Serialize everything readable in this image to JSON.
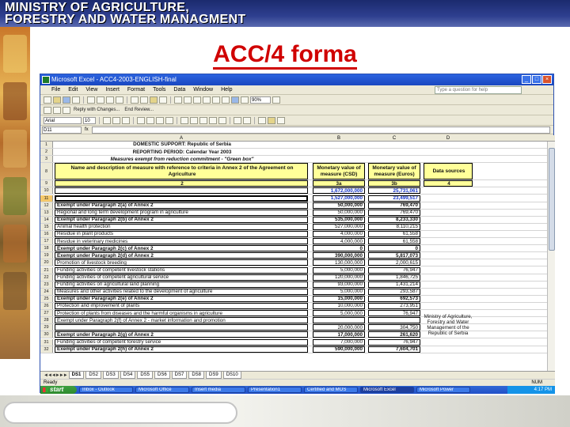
{
  "header": {
    "line1": "MINISTRY OF AGRICULTURE,",
    "line2": "FORESTRY AND WATER MANAGMENT"
  },
  "slide_title": "ACC/4 forma",
  "excel": {
    "window_title": "Microsoft Excel - ACC4-2003-ENGLISH-final",
    "menus": [
      "File",
      "Edit",
      "View",
      "Insert",
      "Format",
      "Tools",
      "Data",
      "Window",
      "Help"
    ],
    "help_placeholder": "Type a question for help",
    "toolbar": {
      "zoom": "90%",
      "font": "Arial",
      "size": "10",
      "reply_label": "Reply with Changes...",
      "end_review_label": "End Review..."
    },
    "name_box": "D11",
    "fx": "fx",
    "columns": [
      "A",
      "B",
      "C",
      "D"
    ],
    "rows": [
      {
        "n": "1",
        "a": "DOMESTIC SUPPORT: Republic of Serbia",
        "b": "",
        "c": "",
        "d": ""
      },
      {
        "n": "2",
        "a": "REPORTING PERIOD: Calendar Year 2003",
        "b": "",
        "c": "",
        "d": ""
      },
      {
        "n": "3",
        "a": "Measures exempt from reduction commitment - \"Green box\"",
        "b": "",
        "c": "",
        "d": ""
      },
      {
        "n": "8",
        "a": "Name and description of measure with reference to criteria in Annex 2 of the Agreement on Agriculture",
        "b": "Monetary value of measure (CSD)",
        "c": "Monetary value of measure (Euros)",
        "d": "Data sources"
      },
      {
        "n": "9",
        "a": "2",
        "b": "3a",
        "c": "3b",
        "d": "4"
      },
      {
        "n": "10",
        "a": "",
        "b": "1,672,000,000",
        "c": "25,731,061",
        "d": ""
      },
      {
        "n": "11",
        "a": "",
        "b": "1,527,000,000",
        "c": "23,499,517",
        "d": ""
      },
      {
        "n": "12",
        "a": "Exempt under Paragraph 2(a) of Annex 2",
        "b": "50,000,000",
        "c": "769,470",
        "d": ""
      },
      {
        "n": "13",
        "a": "Regional and long term development program in agriculture",
        "b": "50,000,000",
        "c": "769,470",
        "d": ""
      },
      {
        "n": "14",
        "a": "Exempt under Paragraph 2(b) of Annex 2",
        "b": "535,000,000",
        "c": "8,233,330",
        "d": ""
      },
      {
        "n": "15",
        "a": "Animal health protection",
        "b": "527,000,000",
        "c": "8,110,215",
        "d": ""
      },
      {
        "n": "16",
        "a": "Residue in plant products",
        "b": "4,000,000",
        "c": "61,558",
        "d": ""
      },
      {
        "n": "17",
        "a": "Residue in veterinary medicines",
        "b": "4,000,000",
        "c": "61,558",
        "d": ""
      },
      {
        "n": "18",
        "a": "Exempt under Paragraph 2(c) of Annex 2",
        "b": "0",
        "c": "0",
        "d": ""
      },
      {
        "n": "19",
        "a": "Exempt under Paragraph 2(d) of Annex 2",
        "b": "390,000,000",
        "c": "5,817,073",
        "d": ""
      },
      {
        "n": "20",
        "a": "Promotion of livestock breeding",
        "b": "130,000,000",
        "c": "2,000,615",
        "d": ""
      },
      {
        "n": "21",
        "a": "Funding activities of competent livestock stations",
        "b": "5,000,000",
        "c": "76,947",
        "d": ""
      },
      {
        "n": "22",
        "a": "Funding activities of competent agricultural service",
        "b": "120,000,000",
        "c": "1,846,725",
        "d": ""
      },
      {
        "n": "23",
        "a": "Funding activities on agricultural land planning",
        "b": "93,000,000",
        "c": "1,431,214",
        "d": ""
      },
      {
        "n": "24",
        "a": "Measures and other activities related to the development of agriculture",
        "b": "5,000,000",
        "c": "293,587",
        "d": ""
      },
      {
        "n": "25",
        "a": "Exempt under Paragraph 2(e) of Annex 2",
        "b": "15,000,000",
        "c": "692,573",
        "d": ""
      },
      {
        "n": "26",
        "a": "Protection and improvement of plants",
        "b": "10,000,000",
        "c": "273,951",
        "d": ""
      },
      {
        "n": "27",
        "a": "Protection of plants from diseases and the harmful organisms in agriculture",
        "b": "5,000,000",
        "c": "76,947",
        "d": ""
      },
      {
        "n": "28",
        "a": "Exempt under Paragraph 2(f) of Annex 2 - market information and promotion",
        "b": "",
        "c": "",
        "d": ""
      },
      {
        "n": "29",
        "a": "",
        "b": "20,000,000",
        "c": "304,750",
        "d": ""
      },
      {
        "n": "30",
        "a": "Exempt under Paragraph 2(g) of Annex 2",
        "b": "17,000,000",
        "c": "261,620",
        "d": ""
      },
      {
        "n": "31",
        "a": "Funding activities of competent forestry service",
        "b": "7,000,000",
        "c": "76,947",
        "d": ""
      },
      {
        "n": "32",
        "a": "Exempt under Paragraph 2(h) of Annex 2",
        "b": "590,000,000",
        "c": "7,604,701",
        "d": ""
      }
    ],
    "data_source_note": "Ministry of Agriculture, Forestry and Water Management of the Republic of Serbia",
    "sheet_tabs": [
      "DS1",
      "DS2",
      "DS3",
      "DS4",
      "DS5",
      "DS6",
      "DS7",
      "DS8",
      "DS9",
      "DS10"
    ],
    "status": "Ready",
    "status_num": "NUM",
    "start_label": "start",
    "tasks": [
      "Inbox - Outlook",
      "Microsoft Office",
      "Insert media",
      "Presentation1",
      "Certified and MOS",
      "Microsoft Excel",
      "Microsoft Power"
    ],
    "clock": "4:17 PM"
  }
}
